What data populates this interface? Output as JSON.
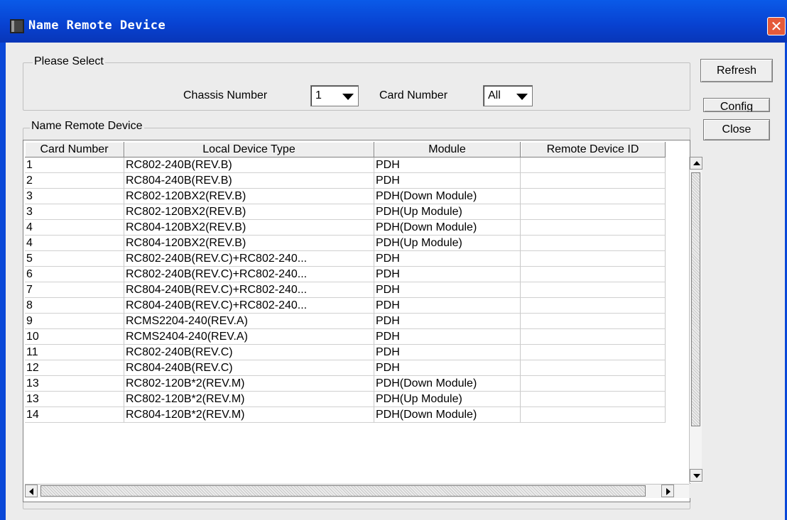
{
  "window": {
    "title": "Name Remote Device",
    "close_glyph": "✕"
  },
  "select_group": {
    "legend": "Please Select",
    "chassis_label": "Chassis Number",
    "chassis_value": "1",
    "card_label": "Card Number",
    "card_value": "All"
  },
  "buttons": {
    "refresh": "Refresh",
    "config": "Config",
    "close": "Close"
  },
  "device_group": {
    "legend": "Name Remote Device"
  },
  "table": {
    "columns": [
      "Card Number",
      "Local Device Type",
      "Module",
      "Remote Device ID"
    ],
    "rows": [
      [
        "1",
        "RC802-240B(REV.B)",
        "PDH",
        ""
      ],
      [
        "2",
        "RC804-240B(REV.B)",
        "PDH",
        ""
      ],
      [
        "3",
        "RC802-120BX2(REV.B)",
        "PDH(Down Module)",
        ""
      ],
      [
        "3",
        "RC802-120BX2(REV.B)",
        "PDH(Up Module)",
        ""
      ],
      [
        "4",
        "RC804-120BX2(REV.B)",
        "PDH(Down Module)",
        ""
      ],
      [
        "4",
        "RC804-120BX2(REV.B)",
        "PDH(Up Module)",
        ""
      ],
      [
        "5",
        "RC802-240B(REV.C)+RC802-240...",
        "PDH",
        ""
      ],
      [
        "6",
        "RC802-240B(REV.C)+RC802-240...",
        "PDH",
        ""
      ],
      [
        "7",
        "RC804-240B(REV.C)+RC802-240...",
        "PDH",
        ""
      ],
      [
        "8",
        "RC804-240B(REV.C)+RC802-240...",
        "PDH",
        ""
      ],
      [
        "9",
        "RCMS2204-240(REV.A)",
        "PDH",
        ""
      ],
      [
        "10",
        "RCMS2404-240(REV.A)",
        "PDH",
        ""
      ],
      [
        "11",
        "RC802-240B(REV.C)",
        "PDH",
        ""
      ],
      [
        "12",
        "RC804-240B(REV.C)",
        "PDH",
        ""
      ],
      [
        "13",
        "RC802-120B*2(REV.M)",
        "PDH(Down Module)",
        ""
      ],
      [
        "13",
        "RC802-120B*2(REV.M)",
        "PDH(Up Module)",
        ""
      ],
      [
        "14",
        "RC804-120B*2(REV.M)",
        "PDH(Down Module)",
        ""
      ]
    ]
  },
  "icons": {
    "window_icon": "device-icon"
  },
  "colors": {
    "titlebar": "#0a48d8",
    "close_button": "#e45a3a",
    "client_bg": "#ececec"
  }
}
